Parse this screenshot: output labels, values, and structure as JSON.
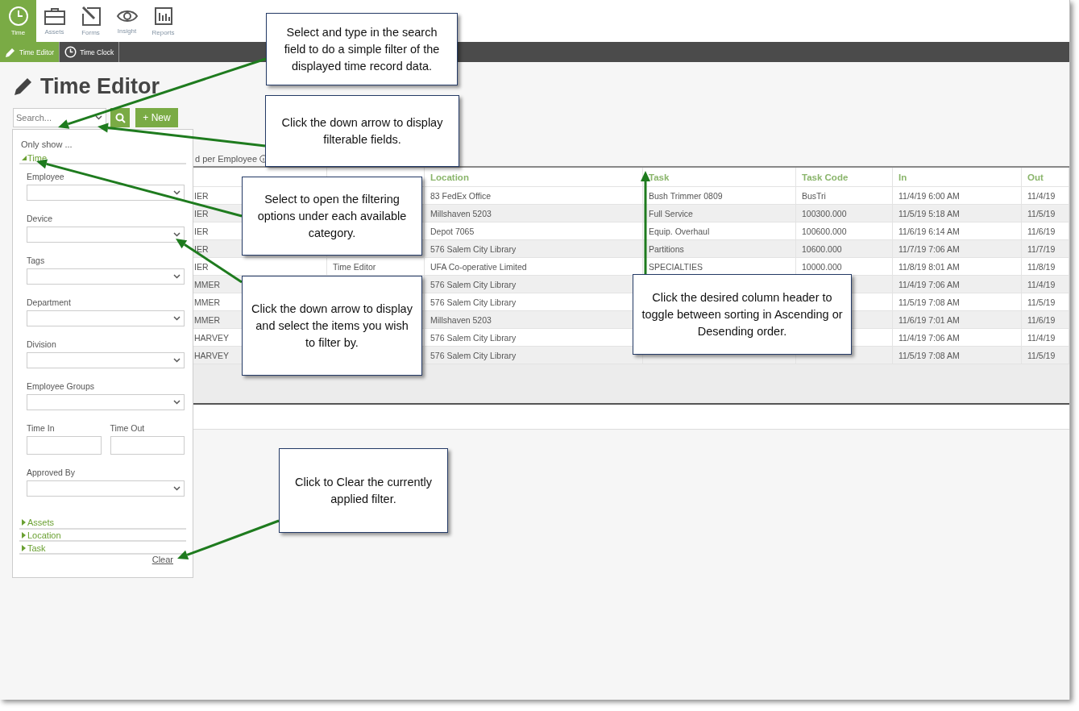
{
  "app_tabs": [
    {
      "label": "Time",
      "selected": true
    },
    {
      "label": "Assets",
      "selected": false
    },
    {
      "label": "Forms",
      "selected": false
    },
    {
      "label": "Insight",
      "selected": false
    },
    {
      "label": "Reports",
      "selected": false
    }
  ],
  "sub_tabs": [
    {
      "label": "Time Editor",
      "selected": true
    },
    {
      "label": "Time Clock",
      "selected": false
    }
  ],
  "page_title": "Time Editor",
  "search": {
    "placeholder": "Search..."
  },
  "new_button": "+ New",
  "summary_text": "d per Employee",
  "table": {
    "columns": [
      "",
      "",
      "Location",
      "Task",
      "Task Code",
      "In",
      "Out"
    ],
    "rows": [
      {
        "cells": [
          "IER",
          null,
          "83 FedEx Office",
          "Bush Trimmer 0809",
          "BusTri",
          "11/4/19 6:00 AM",
          "11/4/19"
        ]
      },
      {
        "cells": [
          "IER",
          null,
          "Millshaven 5203",
          "Full Service",
          "100300.000",
          "11/5/19 5:18 AM",
          "11/5/19"
        ]
      },
      {
        "cells": [
          "IER",
          null,
          "Depot 7065",
          "Equip. Overhaul",
          "100600.000",
          "11/6/19 6:14 AM",
          "11/6/19"
        ]
      },
      {
        "cells": [
          "IER",
          null,
          "576 Salem City Library",
          "Partitions",
          "10600.000",
          "11/7/19 7:06 AM",
          "11/7/19"
        ]
      },
      {
        "cells": [
          "IER",
          "Time Editor",
          "UFA Co-operative Limited",
          "SPECIALTIES",
          "10000.000",
          "11/8/19 8:01 AM",
          "11/8/19"
        ]
      },
      {
        "cells": [
          "MMER",
          null,
          "576 Salem City Library",
          null,
          null,
          "11/4/19 7:06 AM",
          "11/4/19"
        ]
      },
      {
        "cells": [
          "MMER",
          null,
          "576 Salem City Library",
          null,
          null,
          "11/5/19 7:08 AM",
          "11/5/19"
        ]
      },
      {
        "cells": [
          "MMER",
          null,
          "Millshaven 5203",
          null,
          null,
          "11/6/19 7:01 AM",
          "11/6/19"
        ]
      },
      {
        "cells": [
          "HARVEY",
          null,
          "576 Salem City Library",
          null,
          null,
          "11/4/19 7:06 AM",
          "11/4/19"
        ]
      },
      {
        "cells": [
          "HARVEY",
          null,
          "576 Salem City Library",
          null,
          null,
          "11/5/19 7:08 AM",
          "11/5/19"
        ]
      }
    ]
  },
  "filter_panel": {
    "heading": "Only show ...",
    "sections": [
      {
        "label": "Time",
        "expanded": true,
        "fields": [
          {
            "label": "Employee",
            "kind": "select"
          },
          {
            "label": "Device",
            "kind": "select"
          },
          {
            "label": "Tags",
            "kind": "select"
          },
          {
            "label": "Department",
            "kind": "select"
          },
          {
            "label": "Division",
            "kind": "select"
          },
          {
            "label": "Employee Groups",
            "kind": "select"
          },
          {
            "label": "Time In",
            "kind": "text"
          },
          {
            "label": "Time Out",
            "kind": "text"
          },
          {
            "label": "Approved By",
            "kind": "select"
          }
        ]
      },
      {
        "label": "Assets",
        "expanded": false
      },
      {
        "label": "Location",
        "expanded": false
      },
      {
        "label": "Task",
        "expanded": false
      }
    ],
    "clear_link": "Clear"
  },
  "callouts": [
    {
      "text": "Select and type in the search field to do a simple filter of the displayed time record data."
    },
    {
      "text": "Click the down arrow to display filterable fields."
    },
    {
      "text": "Select to open the filtering options under each available category."
    },
    {
      "text": "Click the down arrow to display and select the items you wish to filter by."
    },
    {
      "text": "Click the desired column header to toggle between sorting in Ascending or Desending order."
    },
    {
      "text": "Click to Clear the currently applied filter."
    }
  ]
}
